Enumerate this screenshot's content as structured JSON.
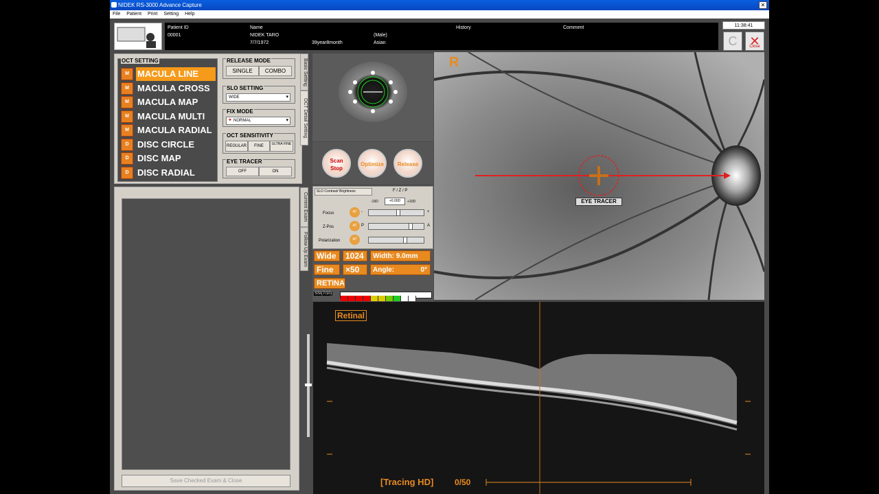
{
  "window": {
    "title": "NIDEK RS-3000 Advance Capture"
  },
  "menu": [
    "File",
    "Patient",
    "Print",
    "Setting",
    "Help"
  ],
  "patient": {
    "id_label": "Patient ID",
    "id": "00001",
    "name_label": "Name",
    "name": "NIDEK  TARO",
    "dob": "7/7/1972",
    "age": "39year8month",
    "sex": "(Male)",
    "race": "Asian",
    "history_label": "History",
    "comment_label": "Comment"
  },
  "clock": "11:38:41",
  "buttons": {
    "close_label": "Close"
  },
  "oct_setting": {
    "title": "OCT SETTING",
    "exams": [
      {
        "icon": "M",
        "label": "MACULA LINE"
      },
      {
        "icon": "M",
        "label": "MACULA CROSS"
      },
      {
        "icon": "M",
        "label": "MACULA MAP"
      },
      {
        "icon": "M",
        "label": "MACULA MULTI"
      },
      {
        "icon": "M",
        "label": "MACULA RADIAL"
      },
      {
        "icon": "D",
        "label": "DISC CIRCLE"
      },
      {
        "icon": "D",
        "label": "DISC MAP"
      },
      {
        "icon": "D",
        "label": "DISC RADIAL"
      }
    ]
  },
  "release_mode": {
    "title": "RELEASE MODE",
    "single": "SINGLE",
    "combo": "COMBO"
  },
  "slo_setting": {
    "title": "SLO SETTING",
    "value": "WIDE"
  },
  "fix_mode": {
    "title": "FIX MODE",
    "value": "NORMAL"
  },
  "oct_sensitivity": {
    "title": "OCT SENSITIVITY",
    "regular": "REGULAR",
    "fine": "FINE",
    "ultra": "ULTRA FINE"
  },
  "eye_tracer": {
    "title": "EYE TRACER",
    "off": "OFF",
    "on": "ON"
  },
  "side_tabs": {
    "basic": "Basic Setting",
    "detail": "OCT Detail Setting",
    "current": "Current Exam",
    "followup": "Follow Up Exam"
  },
  "save_button": "Save Checked Exam & Close",
  "action_buttons": {
    "scan": "Scan Stop",
    "optimize": "Optimize",
    "release": "Release"
  },
  "fzp": {
    "tab": "SLO Contrast/ Brightness",
    "header": "F / Z / P",
    "min_label": "-15D",
    "value": "+0.00D",
    "max_label": "+10D",
    "focus": "Focus",
    "zpos": "Z-Pos",
    "polarization": "Polarization",
    "focus_minus": "-",
    "focus_plus": "+",
    "z_p": "P",
    "z_a": "A",
    "at": "AT"
  },
  "scan_info": {
    "mode": "Wide",
    "resolution": "1024",
    "width": "Width:   9.0mm",
    "quality": "Fine",
    "avg": "×50",
    "angle_label": "Angle:",
    "angle_value": "0°",
    "layer": "RETINA",
    "ssi_label": "SSI(7/10)"
  },
  "slo": {
    "eye": "R",
    "tracer_label": "EYE TRACER"
  },
  "oct": {
    "layer_label": "Retinal",
    "tracing": "[Tracing HD]",
    "count": "0/50"
  },
  "colors": {
    "accent": "#f59a1a",
    "scan_line": "#e02020"
  }
}
